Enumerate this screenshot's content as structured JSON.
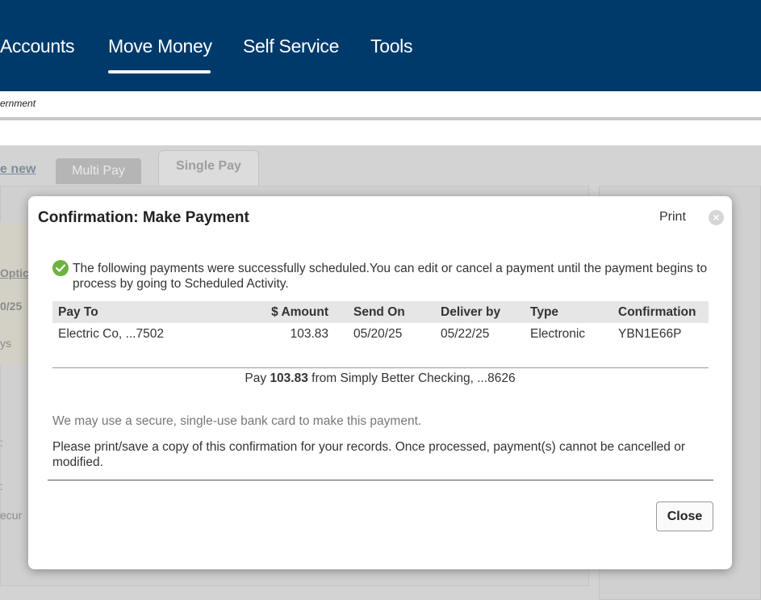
{
  "nav": {
    "items": [
      {
        "label": "Accounts"
      },
      {
        "label": "Move Money"
      },
      {
        "label": "Self Service"
      },
      {
        "label": "Tools"
      }
    ],
    "active": "Move Money"
  },
  "breadcrumb": "ernment",
  "background": {
    "link_text": "e new",
    "tabs": {
      "multi_pay": "Multi Pay",
      "single_pay": "Single Pay"
    },
    "fragments": {
      "optic": "Optic",
      "date": "0/25",
      "days": "ys",
      "colon1": ":",
      "colon2": ":",
      "secure": "ecur"
    }
  },
  "modal": {
    "title": "Confirmation: Make Payment",
    "print_label": "Print",
    "close_x": "×",
    "success_message": "The following payments were successfully scheduled.You can edit or cancel a payment until the payment begins to process by going to Scheduled Activity.",
    "table": {
      "headers": {
        "pay_to": "Pay To",
        "amount": "$ Amount",
        "send_on": "Send On",
        "deliver_by": "Deliver by",
        "type": "Type",
        "confirmation": "Confirmation"
      },
      "rows": [
        {
          "pay_to": "Electric Co, ...7502",
          "amount": "103.83",
          "send_on": "05/20/25",
          "deliver_by": "05/22/25",
          "type": "Electronic",
          "confirmation": "YBN1E66P"
        }
      ]
    },
    "summary": {
      "prefix": "Pay",
      "amount": "103.83",
      "suffix": "from Simply Better Checking, ...8626"
    },
    "note_bank_card": "We may use a secure, single-use bank card to make this payment.",
    "note_print": "Please print/save a copy of this confirmation for your records. Once processed, payment(s) cannot be cancelled or modified.",
    "close_button": "Close"
  },
  "colors": {
    "nav_bg": "#003a6b",
    "success": "#6cb33f"
  }
}
